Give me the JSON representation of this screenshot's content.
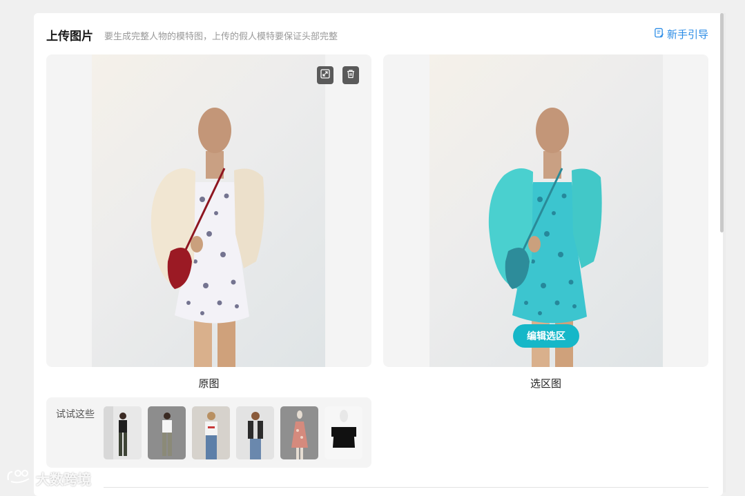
{
  "header": {
    "title": "上传图片",
    "subtitle": "要生成完整人物的模特图，上传的假人模特要保证头部完整",
    "guide_label": "新手引导",
    "guide_icon": "document-edit-icon"
  },
  "original_panel": {
    "caption": "原图",
    "expand_icon": "expand-icon",
    "delete_icon": "trash-icon"
  },
  "selection_panel": {
    "caption": "选区图",
    "edit_label": "编辑选区",
    "highlight_color": "#16b7c8"
  },
  "try_these": {
    "label": "试试这些",
    "thumbnails": [
      {
        "name": "model-black-top"
      },
      {
        "name": "model-white-tshirt"
      },
      {
        "name": "model-printed-tshirt"
      },
      {
        "name": "model-leather-jacket"
      },
      {
        "name": "mannequin-floral-dress"
      },
      {
        "name": "mannequin-black-tshirt"
      }
    ]
  },
  "watermark": {
    "text": "大数跨境"
  },
  "colors": {
    "accent_blue": "#2b8ce6",
    "edit_button": "#16b7c8"
  }
}
